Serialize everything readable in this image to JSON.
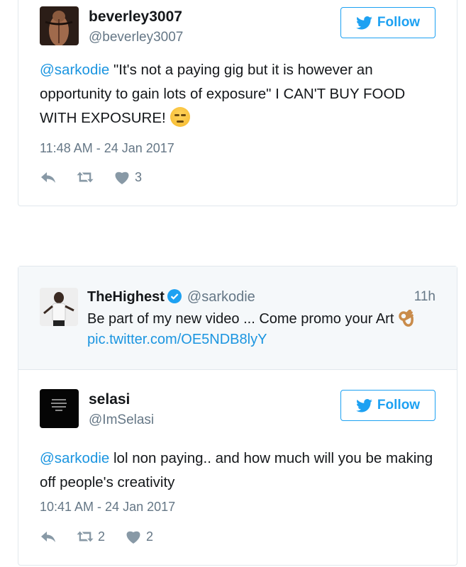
{
  "colors": {
    "brand": "#1da1f2",
    "link": "#1b95e0",
    "muted": "#657786",
    "border": "#e1e8ed"
  },
  "tweets": [
    {
      "name": "beverley3007",
      "handle": "@beverley3007",
      "follow_label": "Follow",
      "mention": "@sarkodie",
      "text": " \"It's not a paying gig but it is however an opportunity to gain lots of exposure\" I CAN'T BUY FOOD WITH EXPOSURE!",
      "emoji": "unamused-face-emoji",
      "timestamp": "11:48 AM - 24 Jan 2017",
      "retweets": "",
      "likes": "3"
    },
    {
      "quoted": {
        "name": "TheHighest",
        "handle": "@sarkodie",
        "time": "11h",
        "text": "Be part of my new video ... Come promo your Art",
        "link": "pic.twitter.com/OE5NDB8lyY"
      },
      "name": "selasi",
      "handle": "@ImSelasi",
      "follow_label": "Follow",
      "mention": "@sarkodie",
      "text": " lol non paying.. and how much will you be making off people's creativity",
      "timestamp": "10:41 AM - 24 Jan 2017",
      "retweets": "2",
      "likes": "2"
    }
  ]
}
